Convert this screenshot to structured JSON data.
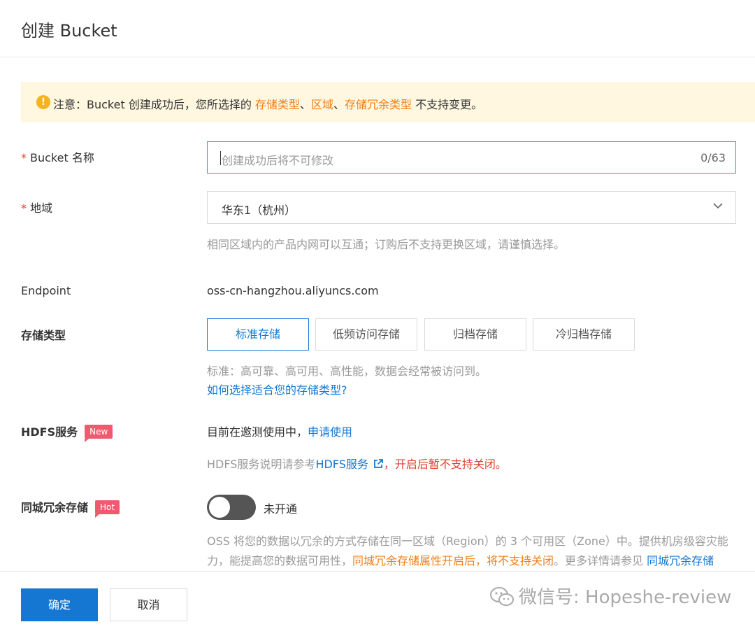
{
  "header": {
    "title": "创建 Bucket"
  },
  "notice": {
    "prefix": "注意：Bucket 创建成功后，您所选择的 ",
    "item1": "存储类型",
    "sep1": "、",
    "item2": "区域",
    "sep2": "、",
    "item3": "存储冗余类型",
    "suffix": " 不支持变更。"
  },
  "form": {
    "bucket_name": {
      "required_mark": "*",
      "label": "Bucket 名称",
      "placeholder": "创建成功后将不可修改",
      "counter": "0/63"
    },
    "region": {
      "required_mark": "*",
      "label": "地域",
      "value": "华东1（杭州）",
      "help": "相同区域内的产品内网可以互通；订购后不支持更换区域，请谨慎选择。"
    },
    "endpoint": {
      "label": "Endpoint",
      "value": "oss-cn-hangzhou.aliyuncs.com"
    },
    "storage_class": {
      "label": "存储类型",
      "options": [
        "标准存储",
        "低频访问存储",
        "归档存储",
        "冷归档存储"
      ],
      "selected": "标准存储",
      "help": "标准：高可靠、高可用、高性能，数据会经常被访问到。",
      "help_link": "如何选择适合您的存储类型?"
    },
    "hdfs": {
      "label": "HDFS服务",
      "badge": "New",
      "status_text": "目前在邀测使用中，",
      "status_link": "申请使用",
      "help_prefix": "HDFS服务说明请参考",
      "help_link": "HDFS服务",
      "help_sep": "，",
      "help_warning": "开启后暂不支持关闭。"
    },
    "zone_redundancy": {
      "label": "同城冗余存储",
      "badge": "Hot",
      "toggle_label": "未开通",
      "enabled": false,
      "desc_prefix": "OSS 将您的数据以冗余的方式存储在同一区域（Region）的 3 个可用区（Zone）中。提供机房级容灾能力，能提高您的数据可用性，",
      "desc_warning": "同城冗余存储属性开启后，将不支持关闭",
      "desc_suffix": "。更多详情请参见 ",
      "desc_link": "同城冗余存储"
    }
  },
  "footer": {
    "confirm_label": "确定",
    "cancel_label": "取消",
    "watermark": "微信号: Hopeshe-review"
  },
  "colors": {
    "primary": "#1677d2",
    "warning_orange": "#f27e16",
    "danger_red": "#e0402f",
    "notice_bg": "#fff7e0",
    "badge_pink": "#ef5a6f"
  },
  "icons": {
    "notice": "exclamation-circle-icon",
    "select": "chevron-down-icon",
    "external": "external-link-icon",
    "watermark": "wechat-icon"
  }
}
